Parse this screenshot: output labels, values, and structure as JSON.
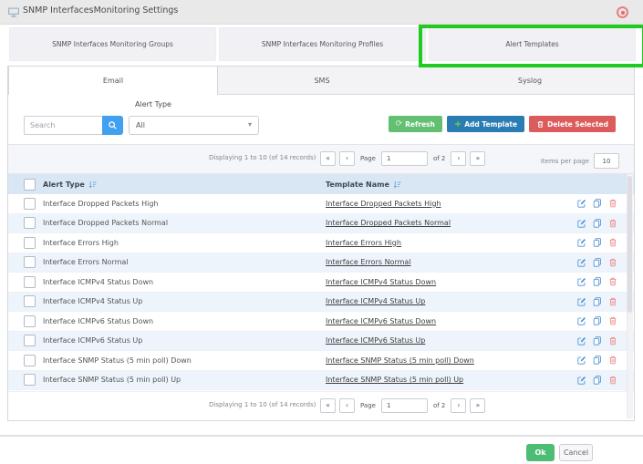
{
  "window": {
    "title": "SNMP InterfacesMonitoring Settings"
  },
  "main_tabs": [
    {
      "label": "SNMP Interfaces Monitoring Groups",
      "active": false
    },
    {
      "label": "SNMP Interfaces Monitoring Profiles",
      "active": false
    },
    {
      "label": "Alert Templates",
      "active": true,
      "highlighted": true
    }
  ],
  "sub_tabs": [
    {
      "label": "Email",
      "active": true
    },
    {
      "label": "SMS",
      "active": false
    },
    {
      "label": "Syslog",
      "active": false
    }
  ],
  "filters": {
    "search_placeholder": "Search",
    "alert_type_label": "Alert Type",
    "alert_type_value": "All"
  },
  "toolbar": {
    "refresh": "Refresh",
    "add_template": "Add Template",
    "delete_selected": "Delete Selected"
  },
  "pagination": {
    "displaying": "Displaying 1 to 10 (of 14 records)",
    "first": "«",
    "prev": "‹",
    "page_label": "Page",
    "page_value": "1",
    "of": "of 2",
    "next": "›",
    "last": "»",
    "items_per_page_label": "Items per page",
    "items_per_page_value": "10"
  },
  "table": {
    "columns": [
      {
        "label": "Alert Type"
      },
      {
        "label": "Template Name"
      }
    ],
    "rows": [
      {
        "alert_type": "Interface Dropped Packets High",
        "template_name": "Interface Dropped Packets High"
      },
      {
        "alert_type": "Interface Dropped Packets Normal",
        "template_name": "Interface Dropped Packets Normal"
      },
      {
        "alert_type": "Interface Errors High",
        "template_name": "Interface Errors High"
      },
      {
        "alert_type": "Interface Errors Normal",
        "template_name": "Interface Errors Normal"
      },
      {
        "alert_type": "Interface ICMPv4 Status Down",
        "template_name": "Interface ICMPv4 Status Down"
      },
      {
        "alert_type": "Interface ICMPv4 Status Up",
        "template_name": "Interface ICMPv4 Status Up"
      },
      {
        "alert_type": "Interface ICMPv6 Status Down",
        "template_name": "Interface ICMPv6 Status Down"
      },
      {
        "alert_type": "Interface ICMPv6 Status Up",
        "template_name": "Interface ICMPv6 Status Up"
      },
      {
        "alert_type": "Interface SNMP Status (5 min poll) Down",
        "template_name": "Interface SNMP Status (5 min poll) Down"
      },
      {
        "alert_type": "Interface SNMP Status (5 min poll) Up",
        "template_name": "Interface SNMP Status (5 min poll) Up"
      }
    ]
  },
  "footer": {
    "ok": "Ok",
    "cancel": "Cancel"
  },
  "icons": {
    "window": "monitor",
    "close": "red-circle",
    "search": "magnifier",
    "refresh": "circular-arrow",
    "add": "plus",
    "delete_selected": "trash",
    "sort": "sort-arrow-bars",
    "dropdown": "chevron-down",
    "row_edit": "pencil-square",
    "row_copy": "duplicate-pages",
    "row_delete": "trash"
  },
  "colors": {
    "annotation": "#1ecb1e",
    "search_button": "#41a0f0",
    "refresh": "#63bf72",
    "add": "#2a7cb5",
    "delete": "#dc5c5c",
    "header_bg": "#d9e7f5",
    "row_alt": "#edf4fb",
    "icon_blue": "#4a8fd4",
    "icon_red": "#ef8a8a",
    "ok": "#4dbd74"
  }
}
